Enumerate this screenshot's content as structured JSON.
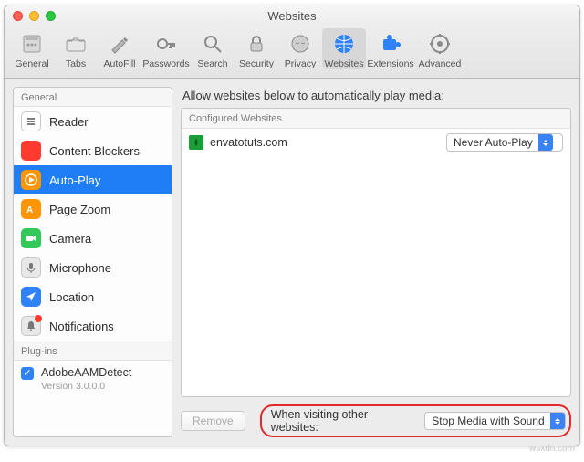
{
  "window": {
    "title": "Websites"
  },
  "toolbar": {
    "items": [
      {
        "name": "general",
        "label": "General"
      },
      {
        "name": "tabs",
        "label": "Tabs"
      },
      {
        "name": "autofill",
        "label": "AutoFill"
      },
      {
        "name": "passwords",
        "label": "Passwords"
      },
      {
        "name": "search",
        "label": "Search"
      },
      {
        "name": "security",
        "label": "Security"
      },
      {
        "name": "privacy",
        "label": "Privacy"
      },
      {
        "name": "websites",
        "label": "Websites",
        "selected": true
      },
      {
        "name": "extensions",
        "label": "Extensions"
      },
      {
        "name": "advanced",
        "label": "Advanced"
      }
    ]
  },
  "sidebar": {
    "section_general": "General",
    "items": [
      {
        "name": "reader",
        "label": "Reader"
      },
      {
        "name": "content-blockers",
        "label": "Content Blockers"
      },
      {
        "name": "auto-play",
        "label": "Auto-Play",
        "selected": true
      },
      {
        "name": "page-zoom",
        "label": "Page Zoom"
      },
      {
        "name": "camera",
        "label": "Camera"
      },
      {
        "name": "microphone",
        "label": "Microphone"
      },
      {
        "name": "location",
        "label": "Location"
      },
      {
        "name": "notifications",
        "label": "Notifications"
      }
    ],
    "section_plugins": "Plug-ins",
    "plugin": {
      "name": "AdobeAAMDetect",
      "version": "Version 3.0.0.0",
      "checked": true
    }
  },
  "main": {
    "heading": "Allow websites below to automatically play media:",
    "list_header": "Configured Websites",
    "sites": [
      {
        "domain": "envatotuts.com",
        "policy": "Never Auto-Play"
      }
    ],
    "remove_label": "Remove",
    "other_label": "When visiting other websites:",
    "other_value": "Stop Media with Sound"
  },
  "watermark": "wsxdn.com"
}
